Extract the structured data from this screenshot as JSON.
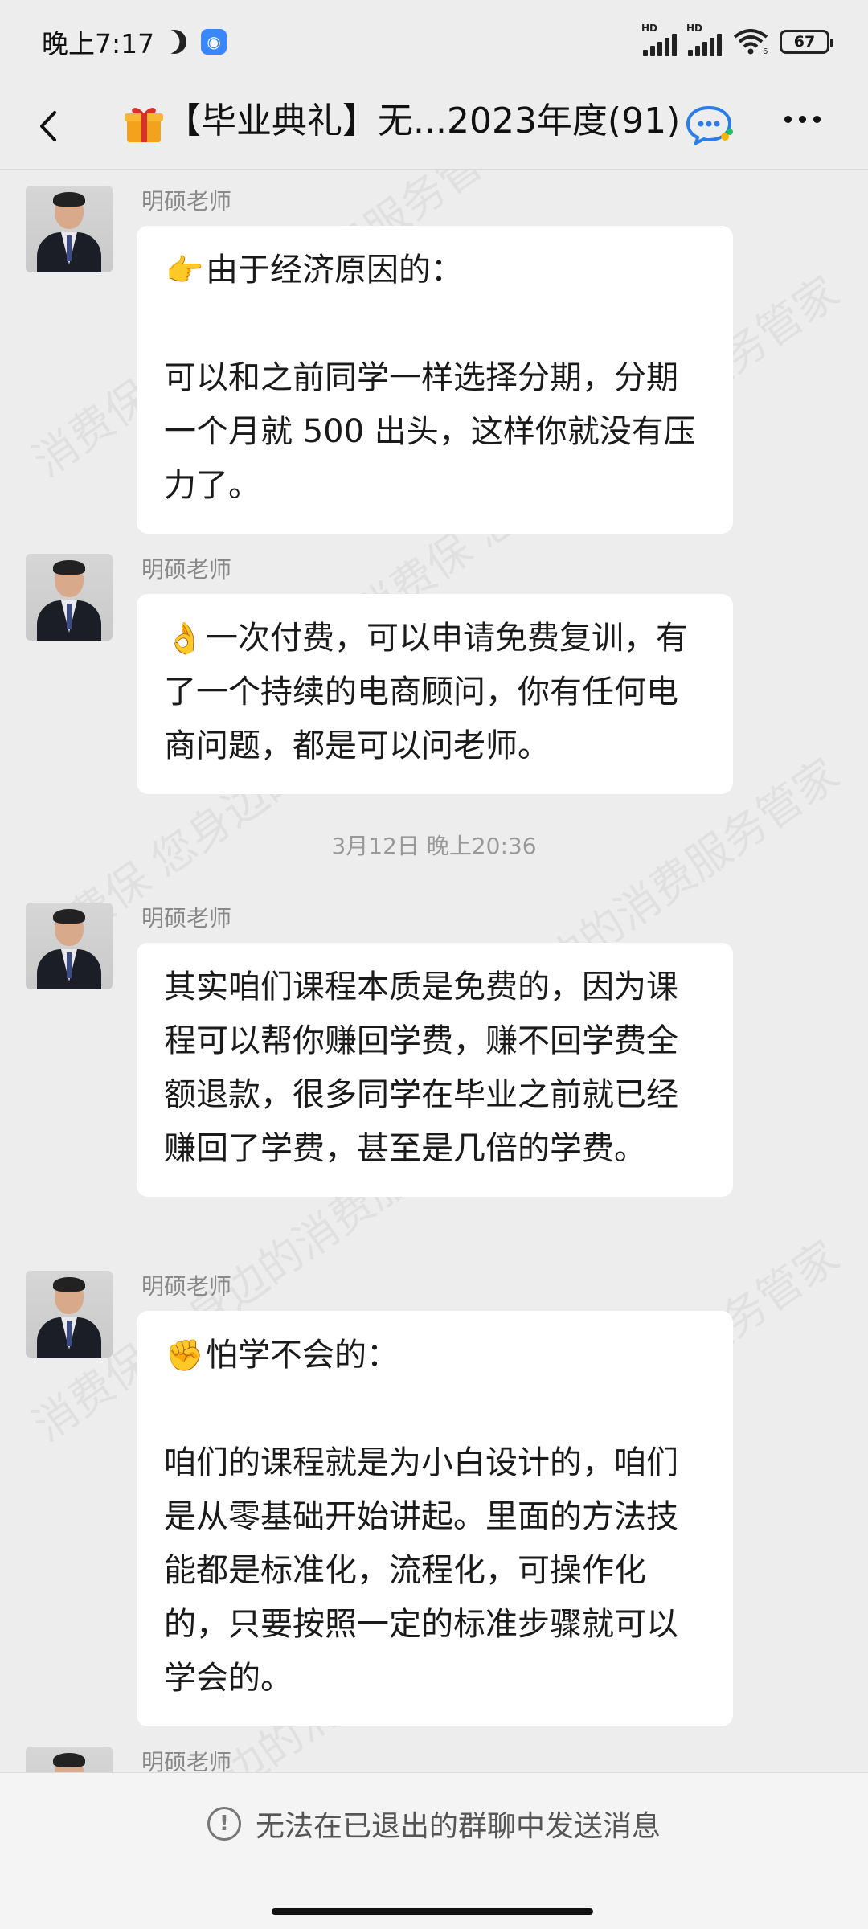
{
  "status_bar": {
    "time": "晚上7:17",
    "signal_1_label": "HD",
    "signal_2_label": "HD",
    "wifi_sub": "6",
    "battery": "67"
  },
  "nav": {
    "title": "【毕业典礼】无...2023年度(91)"
  },
  "messages": [
    {
      "sender": "明硕老师",
      "emoji": "👉",
      "lines": [
        "由于经济原因的：",
        "",
        "可以和之前同学一样选择分期，分期一个月就 500 出头，这样你就没有压力了。"
      ]
    },
    {
      "sender": "明硕老师",
      "emoji": "👌",
      "lines": [
        "一次付费，可以申请免费复训，有了一个持续的电商顾问，你有任何电商问题，都是可以问老师。"
      ]
    },
    {
      "sender": "明硕老师",
      "emoji": "",
      "lines": [
        "其实咱们课程本质是免费的，因为课程可以帮你赚回学费，赚不回学费全额退款，很多同学在毕业之前就已经赚回了学费，甚至是几倍的学费。"
      ]
    },
    {
      "sender": "明硕老师",
      "emoji": "✊",
      "lines": [
        "怕学不会的：",
        "",
        "咱们的课程就是为小白设计的，咱们是从零基础开始讲起。里面的方法技能都是标准化，流程化，可操作化的，只要按照一定的标准步骤就可以学会的。"
      ]
    },
    {
      "sender": "明硕老师"
    }
  ],
  "timestamp": "3月12日 晚上20:36",
  "footer": {
    "notice": "无法在已退出的群聊中发送消息"
  },
  "watermark_text": "消费保 您身边的消费服务管家"
}
